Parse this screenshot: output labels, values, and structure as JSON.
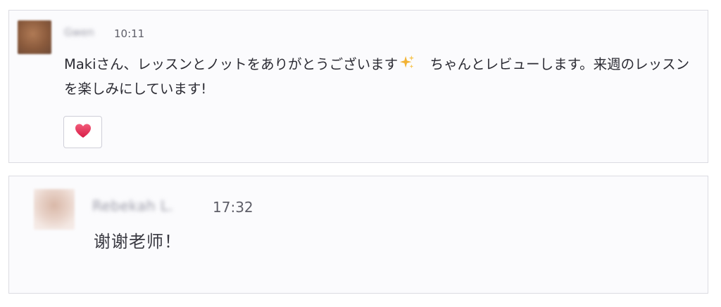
{
  "messages": [
    {
      "author": "Gwen",
      "time": "10:11",
      "text_part1": "Makiさん、レッスンとノットをありがとうございます",
      "emoji": "sparkles-icon",
      "text_part2": "　ちゃんとレビューします。来週のレッスンを楽しみにしています!",
      "reactions": [
        {
          "emoji": "heart-icon",
          "color": "#e8334f"
        }
      ]
    },
    {
      "author": "Rebekah L.",
      "time": "17:32",
      "text": "谢谢老师！"
    }
  ],
  "colors": {
    "card_background": "#fbfbfd",
    "card_border": "#dcdce2",
    "time_text": "#5e5e68",
    "body_text": "#2b2b33",
    "sparkle": "#f2b233",
    "heart": "#e8334f"
  }
}
